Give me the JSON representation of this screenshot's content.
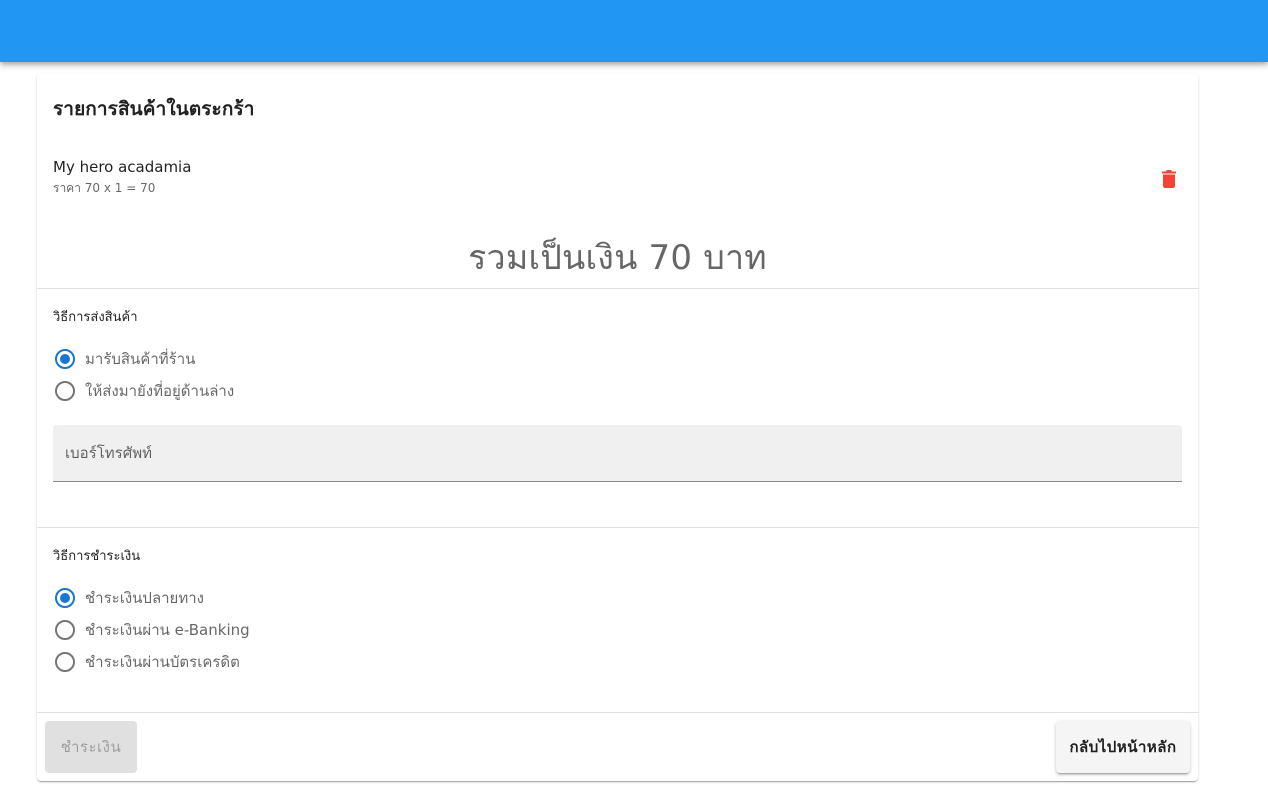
{
  "colors": {
    "app_bar": "#2196f3",
    "accent": "#1976d2",
    "delete_icon": "#f44336"
  },
  "cart": {
    "title": "รายการสินค้าในตระกร้า",
    "items": [
      {
        "name": "My hero acadamia",
        "price_text": "ราคา 70 x 1 = 70",
        "delete_icon": "trash-icon"
      }
    ],
    "total_text": "รวมเป็นเงิน 70 บาท"
  },
  "shipping": {
    "label": "วิธีการส่งสินค้า",
    "options": [
      {
        "label": "มารับสินค้าที่ร้าน",
        "checked": true
      },
      {
        "label": "ให้ส่งมายังที่อยู่ด้านล่าง",
        "checked": false
      }
    ],
    "phone_placeholder": "เบอร์โทรศัพท์",
    "phone_value": ""
  },
  "payment": {
    "label": "วิธีการชำระเงิน",
    "options": [
      {
        "label": "ชำระเงินปลายทาง",
        "checked": true
      },
      {
        "label": "ชำระเงินผ่าน e-Banking",
        "checked": false
      },
      {
        "label": "ชำระเงินผ่านบัตรเครดิต",
        "checked": false
      }
    ]
  },
  "actions": {
    "pay_label": "ชำระเงิน",
    "back_label": "กลับไปหน้าหลัก"
  }
}
